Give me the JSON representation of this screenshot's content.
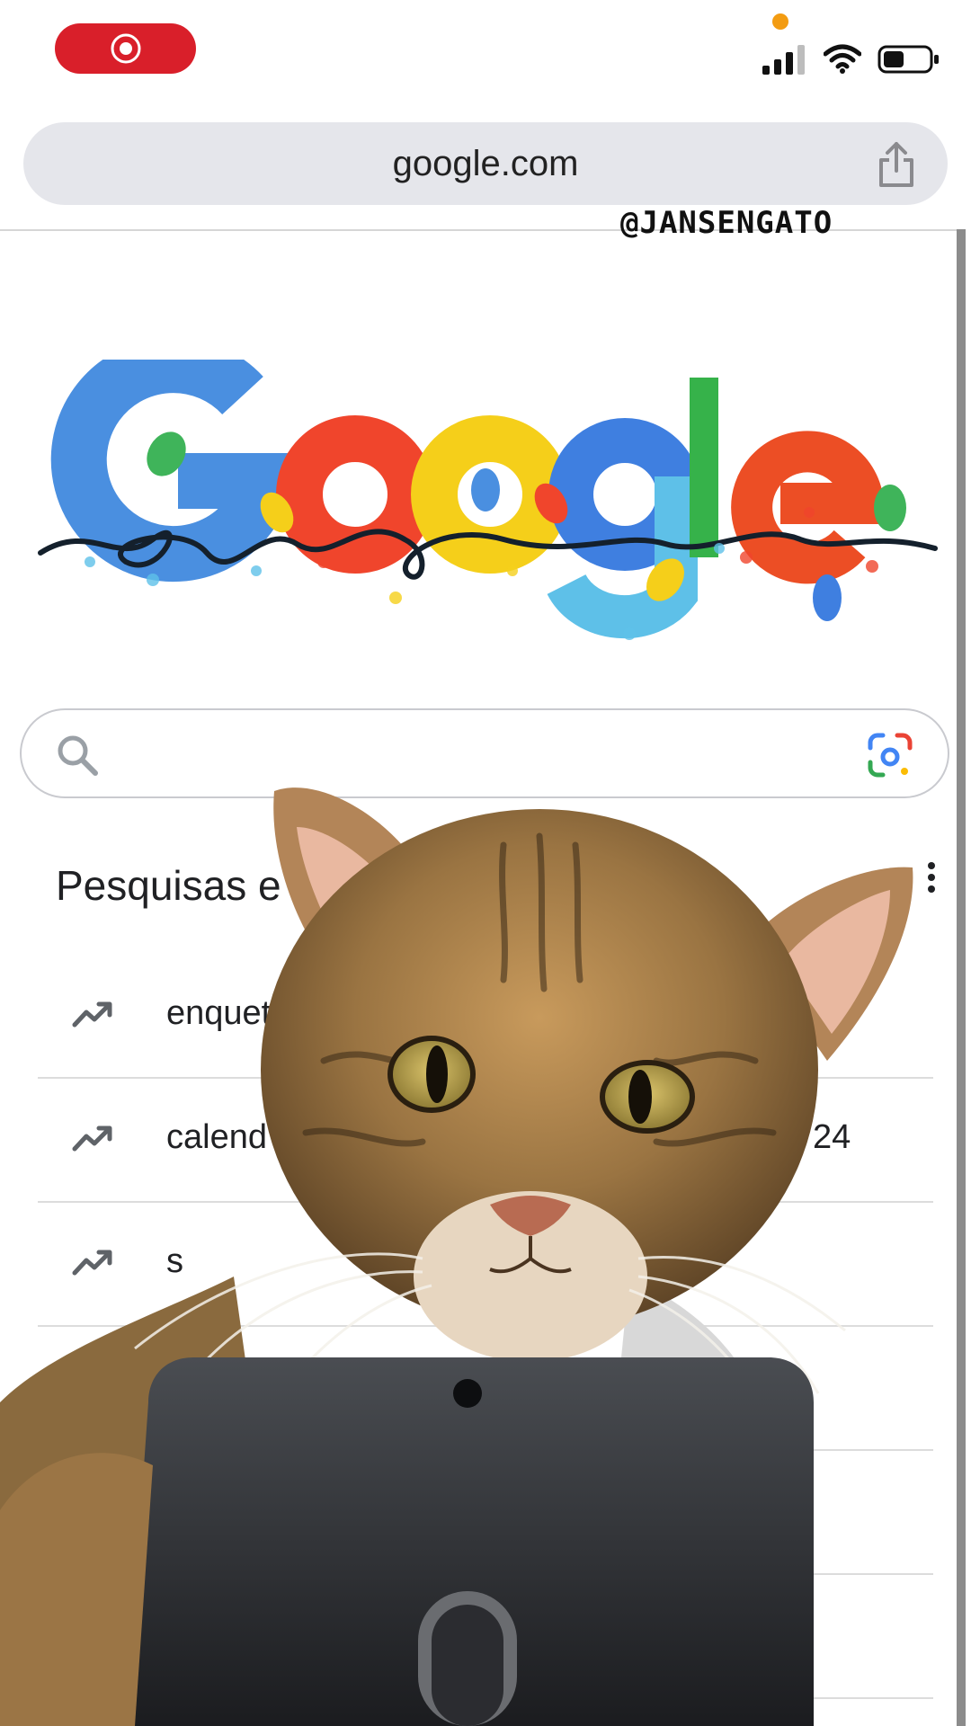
{
  "status_bar": {
    "record_icon": "screen-record-icon",
    "signal_icon": "cellular-signal-icon",
    "wifi_icon": "wifi-icon",
    "battery_icon": "battery-icon"
  },
  "browser": {
    "url": "google.com",
    "share_icon": "share-icon"
  },
  "watermark": "@JANSENGATO",
  "doodle": {
    "logo_text": "Google",
    "colors": {
      "blue": "#4285f4",
      "red": "#ea4335",
      "yellow": "#fbbc05",
      "green": "#34a853"
    }
  },
  "search": {
    "placeholder": "",
    "search_icon": "search-icon",
    "lens_icon": "google-lens-icon"
  },
  "trends": {
    "title": "Pesquisas e",
    "more_icon": "more-vert-icon",
    "items": [
      {
        "label": "enquete",
        "suffix": ""
      },
      {
        "label": "calend",
        "suffix": "24"
      },
      {
        "label": "s",
        "suffix": ""
      },
      {
        "label": "",
        "suffix": ""
      },
      {
        "label": "",
        "suffix": ""
      },
      {
        "label": "",
        "suffix": ""
      }
    ]
  },
  "overlay": {
    "subject": "cat-holding-phone-image"
  }
}
